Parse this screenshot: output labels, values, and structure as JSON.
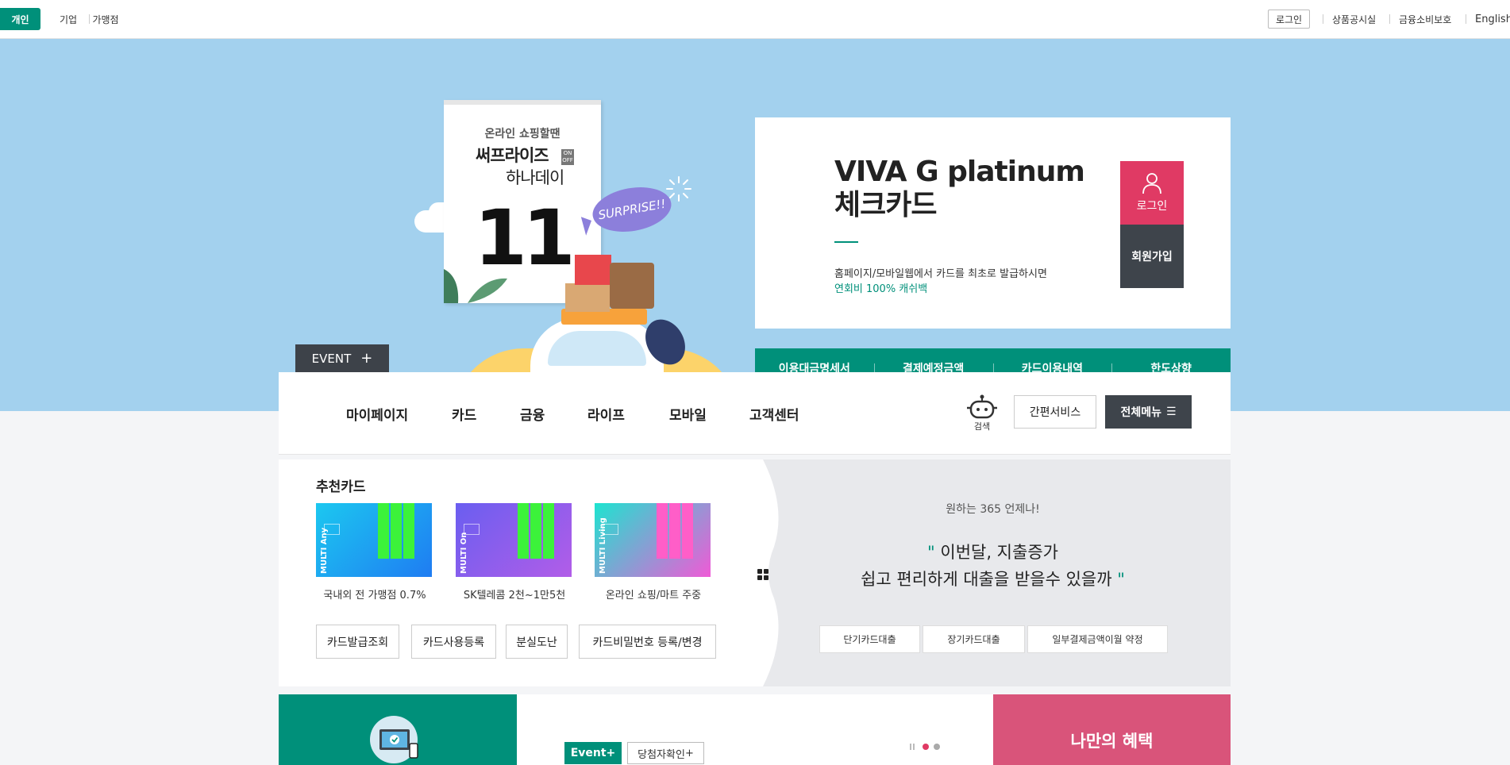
{
  "topbar": {
    "segments": [
      {
        "label": "개인",
        "active": true
      },
      {
        "label": "기업",
        "active": false
      },
      {
        "label": "가맹점",
        "active": false
      }
    ],
    "util": {
      "login": "로그인",
      "product_notice": "상품공시실",
      "consumer_protection": "금융소비보호",
      "english": "English"
    }
  },
  "hero": {
    "calendar": {
      "subtitle": "온라인 쇼핑할땐",
      "brand_line1": "써프라이즈",
      "brand_line2": "하나데이",
      "on_off": "ON OFF",
      "number": "11",
      "bubble": "SURPRISE!!"
    },
    "event_tab": {
      "label": "EVENT",
      "icon": "plus-icon"
    },
    "product": {
      "title_line1": "VIVA G platinum",
      "title_line2": "체크카드",
      "desc": "홈페이지/모바일웹에서 카드를 최초로 발급하시면",
      "desc_highlight": "연회비 100% 캐쉬백",
      "login_label": "로그인",
      "join_label": "회원가입"
    },
    "quick_menu": [
      "이용대금명세서",
      "결제예정금액",
      "카드이용내역",
      "한도상향"
    ]
  },
  "gnb": {
    "items": [
      "마이페이지",
      "카드",
      "금융",
      "라이프",
      "모바일",
      "고객센터"
    ],
    "search_label": "검색",
    "simple_service": "간편서비스",
    "all_menu": "전체메뉴"
  },
  "recommend": {
    "title": "추천카드",
    "cards": [
      {
        "caption": "국내외 전 가맹점 0.7%",
        "brand": "MULTI Any"
      },
      {
        "caption": "SK텔레콤 2천~1만5천",
        "brand": "MULTI On"
      },
      {
        "caption": "온라인 쇼핑/마트 주중",
        "brand": "MULTI Living"
      }
    ],
    "buttons": [
      "카드발급조회",
      "카드사용등록",
      "분실도난",
      "카드비밀번호 등록/변경"
    ]
  },
  "loan": {
    "subtitle": "원하는 365 언제나!",
    "quote_open": "\"",
    "message_line1": "이번달, 지출증가",
    "message_line2": "쉽고 편리하게 대출을 받을수 있을까",
    "quote_close": "\"",
    "buttons": [
      "단기카드대출",
      "장기카드대출",
      "일부결제금액이월 약정"
    ]
  },
  "bottom": {
    "event_label": "Event",
    "winner_label": "당첨자확인",
    "my_benefit": "나만의 혜택"
  },
  "colors": {
    "primary": "#00907a",
    "accent": "#e03a64",
    "dark": "#3e444b",
    "sky": "#a3d1ee"
  }
}
